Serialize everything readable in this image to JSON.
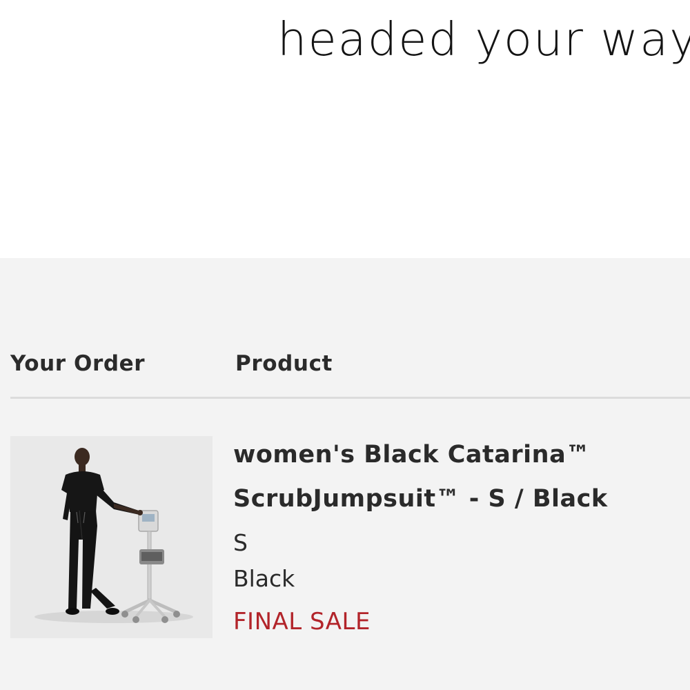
{
  "header": {
    "headline": "headed your way"
  },
  "order": {
    "your_order_label": "Your Order",
    "product_label": "Product",
    "items": [
      {
        "title_line_1": "women's Black Catarina™",
        "title_line_2": "ScrubJumpsuit™ - S / Black",
        "size": "S",
        "color": "Black",
        "badge": "FINAL SALE"
      }
    ]
  },
  "colors": {
    "sale_red": "#b2242a",
    "panel_background": "#f3f3f3",
    "divider": "#dcdcdc"
  }
}
